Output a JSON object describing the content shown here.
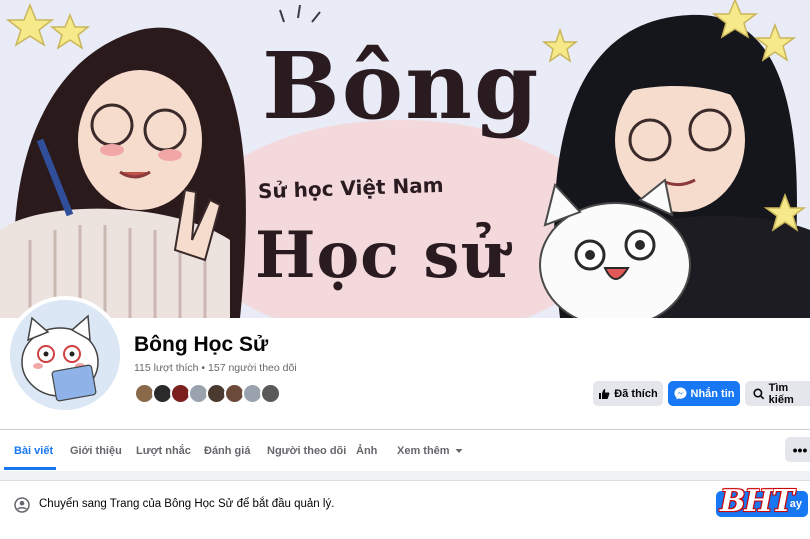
{
  "cover": {
    "title_top": "Bông",
    "subtitle": "Sử học Việt Nam",
    "title_bottom": "Học sử"
  },
  "profile": {
    "name": "Bông Học Sử",
    "stats": "115 lượt thích • 157 người theo dõi",
    "friend_avatar_colors": [
      "#8a6a4a",
      "#2a2a2a",
      "#7b1f1f",
      "#9aa3ad",
      "#4a3a30",
      "#6b4a3a",
      "#9aa3ad",
      "#5a5a5a"
    ]
  },
  "actions": {
    "liked": "Đã thích",
    "message": "Nhắn tin",
    "search": "Tìm kiếm"
  },
  "tabs": [
    {
      "label": "Bài viết",
      "active": true
    },
    {
      "label": "Giới thiệu"
    },
    {
      "label": "Lượt nhắc"
    },
    {
      "label": "Đánh giá"
    },
    {
      "label": "Người theo dõi"
    },
    {
      "label": "Ảnh"
    },
    {
      "label": "Xem thêm"
    }
  ],
  "more_menu": "•••",
  "banner": {
    "text": "Chuyển sang Trang của Bông Học Sử để bắt đầu quản lý.",
    "button": "ay"
  },
  "watermark": "BHT",
  "colors": {
    "accent": "#1877f2",
    "watermark": "#cc0000"
  }
}
